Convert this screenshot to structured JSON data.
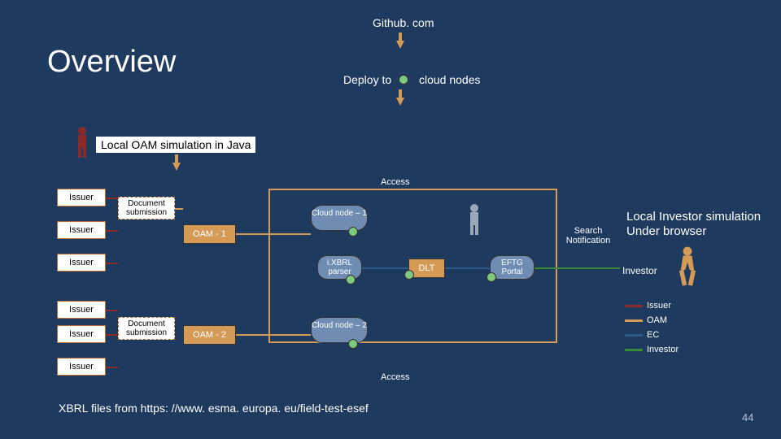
{
  "title": "Overview",
  "header": {
    "github": "Github. com",
    "deploy_to": "Deploy to",
    "cloud_nodes": "cloud nodes"
  },
  "local_sim": "Local OAM simulation in Java",
  "access": "Access",
  "issuer": "Issuer",
  "doc_submission": "Document submission",
  "oam1": "OAM - 1",
  "oam2": "OAM - 2",
  "cloud1": "Cloud node – 1",
  "cloud2": "Cloud node – 2",
  "ixbrl": "i.XBRL parser",
  "dlt": "DLT",
  "eftg": "EFTG Portal",
  "search_notif": "Search Notification",
  "investor": "Investor",
  "investor_sim_l1": "Local Investor simulation",
  "investor_sim_l2": "Under browser",
  "legend": {
    "issuer": "Issuer",
    "oam": "OAM",
    "ec": "EC",
    "investor": "Investor"
  },
  "footer": "XBRL files from https: //www. esma. europa. eu/field-test-esef",
  "page": "44",
  "colors": {
    "issuer": "#8a2a2a",
    "oam": "#d59a56",
    "ec": "#2a5a8a",
    "investor": "#3a8a3a"
  }
}
